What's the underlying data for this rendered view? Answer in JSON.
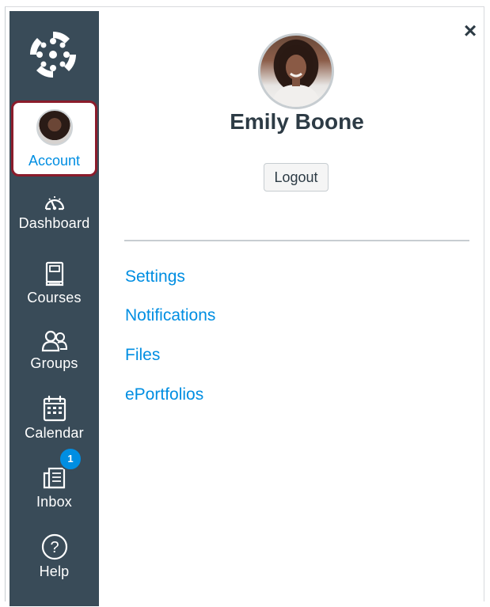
{
  "nav": {
    "logo_icon": "canvas-logo-icon",
    "account": {
      "label": "Account",
      "active": true
    },
    "items": [
      {
        "label": "Dashboard",
        "icon": "dashboard-icon"
      },
      {
        "label": "Courses",
        "icon": "courses-icon"
      },
      {
        "label": "Groups",
        "icon": "groups-icon"
      },
      {
        "label": "Calendar",
        "icon": "calendar-icon"
      },
      {
        "label": "Inbox",
        "icon": "inbox-icon",
        "badge": "1"
      },
      {
        "label": "Help",
        "icon": "help-icon"
      }
    ]
  },
  "tray": {
    "close_label": "×",
    "user_name": "Emily Boone",
    "logout_label": "Logout",
    "links": [
      {
        "label": "Settings"
      },
      {
        "label": "Notifications"
      },
      {
        "label": "Files"
      },
      {
        "label": "ePortfolios"
      }
    ]
  },
  "colors": {
    "nav_bg": "#394b58",
    "link": "#008ee2",
    "active_border": "#8b1c2b",
    "text_dark": "#2d3b45"
  }
}
